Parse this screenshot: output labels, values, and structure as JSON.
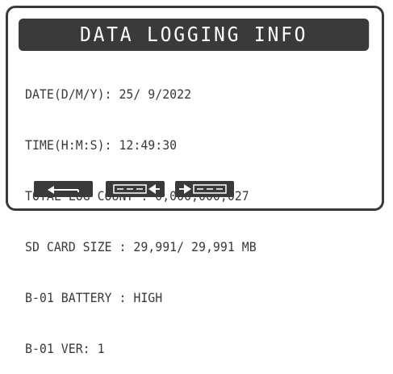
{
  "title": "DATA LOGGING INFO",
  "lines": [
    "DATE(D/M/Y): 25/ 9/2022",
    "TIME(H:M:S): 12:49:30",
    "TOTAL LOG COUNT : 0,000,000,027",
    "SD CARD SIZE : 29,991/ 29,991 MB",
    "B-01 BATTERY : HIGH",
    "B-01 VER: 1"
  ],
  "buttons": [
    {
      "icon": "back-arrow-icon"
    },
    {
      "icon": "erase-left-icon"
    },
    {
      "icon": "insert-right-icon"
    }
  ],
  "colors": {
    "foreground": "#3a3a3a",
    "background": "#ffffff"
  }
}
